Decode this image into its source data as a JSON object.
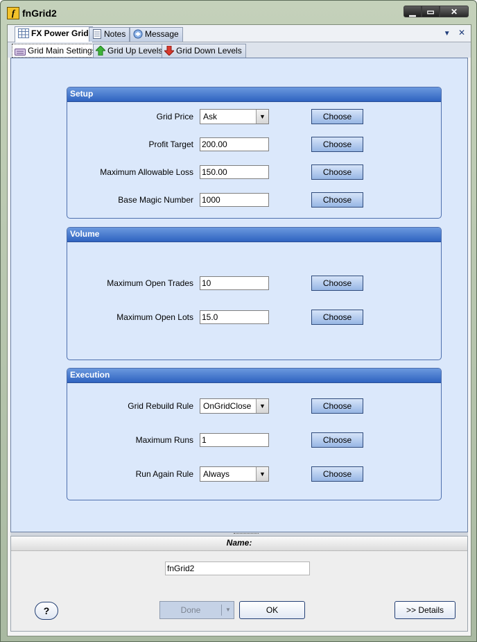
{
  "window": {
    "title": "fnGrid2",
    "app_icon_glyph": "f",
    "controls": {
      "minimize": "▁",
      "maximize": "▭",
      "close": "✕"
    }
  },
  "tabs": {
    "items": [
      {
        "label": "FX Power Grid",
        "icon": "grid-icon",
        "active": true
      },
      {
        "label": "Notes",
        "icon": "notes-icon",
        "active": false
      },
      {
        "label": "Message",
        "icon": "message-icon",
        "active": false
      }
    ],
    "actions": {
      "dropdown": "▼",
      "close": "✕"
    }
  },
  "subtabs": {
    "items": [
      {
        "label": "Grid Main Settings",
        "icon": "keyboard-icon",
        "active": true
      },
      {
        "label": "Grid Up Levels",
        "icon": "green-up-arrow-icon",
        "active": false
      },
      {
        "label": "Grid Down Levels",
        "icon": "red-down-arrow-icon",
        "active": false
      }
    ]
  },
  "setup": {
    "title": "Setup",
    "grid_price": {
      "label": "Grid Price",
      "value": "Ask"
    },
    "profit_target": {
      "label": "Profit Target",
      "value": "200.00"
    },
    "max_loss": {
      "label": "Maximum Allowable Loss",
      "value": "150.00"
    },
    "magic": {
      "label": "Base Magic Number",
      "value": "1000"
    }
  },
  "volume": {
    "title": "Volume",
    "max_trades": {
      "label": "Maximum Open Trades",
      "value": "10"
    },
    "max_lots": {
      "label": "Maximum Open Lots",
      "value": "15.0"
    }
  },
  "execution": {
    "title": "Execution",
    "rebuild_rule": {
      "label": "Grid Rebuild Rule",
      "value": "OnGridClose"
    },
    "max_runs": {
      "label": "Maximum Runs",
      "value": "1"
    },
    "run_again": {
      "label": "Run Again Rule",
      "value": "Always"
    }
  },
  "common": {
    "choose_label": "Choose",
    "dropdown_arrow": "▼"
  },
  "footer": {
    "name_label": "Name:",
    "name_value": "fnGrid2",
    "help_label": "?",
    "done_label": "Done",
    "done_arrow": "▼",
    "ok_label": "OK",
    "details_label": ">> Details"
  },
  "colors": {
    "panel_bg": "#dbe8fb",
    "group_header_top": "#6a98de",
    "group_header_bottom": "#2f63c0",
    "choose_button": "#97b6e4"
  }
}
